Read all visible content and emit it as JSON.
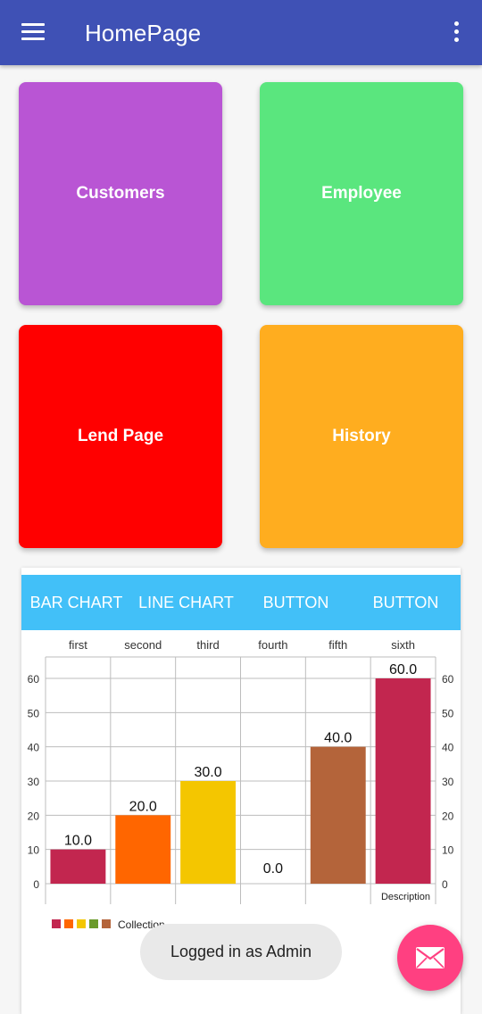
{
  "appbar": {
    "title": "HomePage",
    "menu_icon": "menu-icon",
    "more_icon": "more-vert-icon",
    "color": "#3f51b5"
  },
  "tiles": [
    {
      "label": "Customers",
      "color": "#b955d4"
    },
    {
      "label": "Employee",
      "color": "#5ae67e"
    },
    {
      "label": "Lend Page",
      "color": "#ff0000"
    },
    {
      "label": "History",
      "color": "#ffad1f"
    }
  ],
  "chart_tabs": [
    "BAR CHART",
    "LINE CHART",
    "BUTTON",
    "BUTTON"
  ],
  "chart_data": {
    "type": "bar",
    "categories": [
      "first",
      "second",
      "third",
      "fourth",
      "fifth",
      "sixth"
    ],
    "values": [
      10.0,
      20.0,
      30.0,
      0.0,
      40.0,
      60.0
    ],
    "value_labels": [
      "10.0",
      "20.0",
      "30.0",
      "0.0",
      "40.0",
      "60.0"
    ],
    "colors": [
      "#c2264f",
      "#ff6600",
      "#f4c600",
      "#6a9a2a",
      "#b4643a",
      "#c2264f"
    ],
    "ylim": [
      0,
      60
    ],
    "yticks": [
      "0",
      "10",
      "20",
      "30",
      "40",
      "50",
      "60"
    ],
    "description": "Description",
    "legend": {
      "label": "Collection",
      "colors": [
        "#c2264f",
        "#ff6600",
        "#f4c600",
        "#6a9a2a",
        "#b4643a"
      ]
    },
    "grid": true
  },
  "toast": "Logged in as Admin",
  "fab": {
    "icon": "mail-icon",
    "color": "#ff4081"
  }
}
